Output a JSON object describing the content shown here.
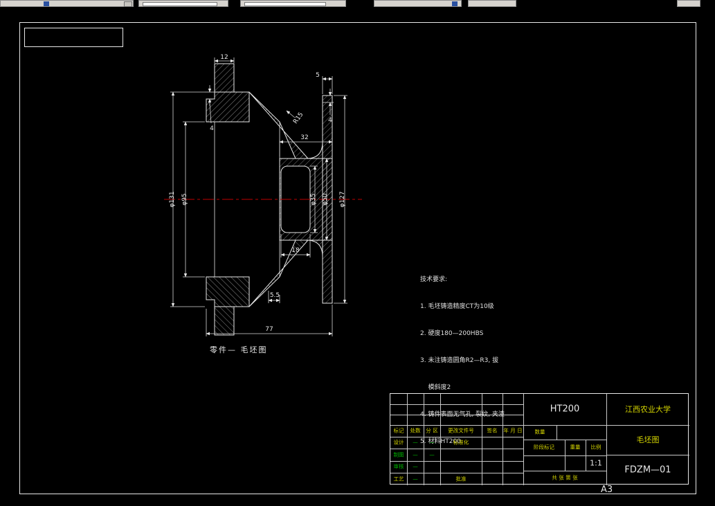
{
  "colors": {
    "background": "#000000",
    "line": "#e8e8e8",
    "centerline": "#c00000",
    "label_yellow": "#d4d400",
    "label_green": "#00b400",
    "toolbar": "#d6d3ce"
  },
  "view": {
    "caption": "零件— 毛坯图",
    "dims": {
      "d12": "12",
      "d5": "5",
      "r15": "R15",
      "d32": "32",
      "d4_left": "4",
      "d4_right": "4",
      "d95": "φ95",
      "d131": "φ131",
      "d35": "φ35",
      "d50": "φ50",
      "d127": "φ127",
      "d18": "18",
      "d5_5": "5.5",
      "d77": "77"
    }
  },
  "notes": {
    "title": "技术要求:",
    "lines": [
      "1. 毛坯铸造精度CT为10级",
      "2. 硬度180—200HBS",
      "3. 未注铸造圆角R2—R3, 拔",
      "    模斜度2",
      "4. 铸件表面无气孔, 裂纹, 夹渣",
      "5. 材料HT200"
    ]
  },
  "title_block": {
    "material": "HT200",
    "company": "江西农业大学",
    "title": "毛坯图",
    "code": "FDZM—01",
    "scale_value": "1:1",
    "sheet": "A3",
    "rev_headers": [
      "标记",
      "处数",
      "分 区",
      "更改文件号",
      "签名",
      "年 月 日"
    ],
    "qty_label": "数量",
    "stage_label": "阶段标记",
    "weight_label": "重量",
    "scale_label": "比例",
    "sheet_note": "共 张 第 张",
    "rows": [
      {
        "label": "设计",
        "sig": "—",
        "date": "—",
        "extra": "标准化"
      },
      {
        "label": "制图",
        "sig": "—",
        "date": "—",
        "extra": ""
      },
      {
        "label": "审核",
        "sig": "—",
        "date": "",
        "extra": ""
      },
      {
        "label": "工艺",
        "sig": "—",
        "date": "",
        "extra": "批准"
      }
    ]
  }
}
